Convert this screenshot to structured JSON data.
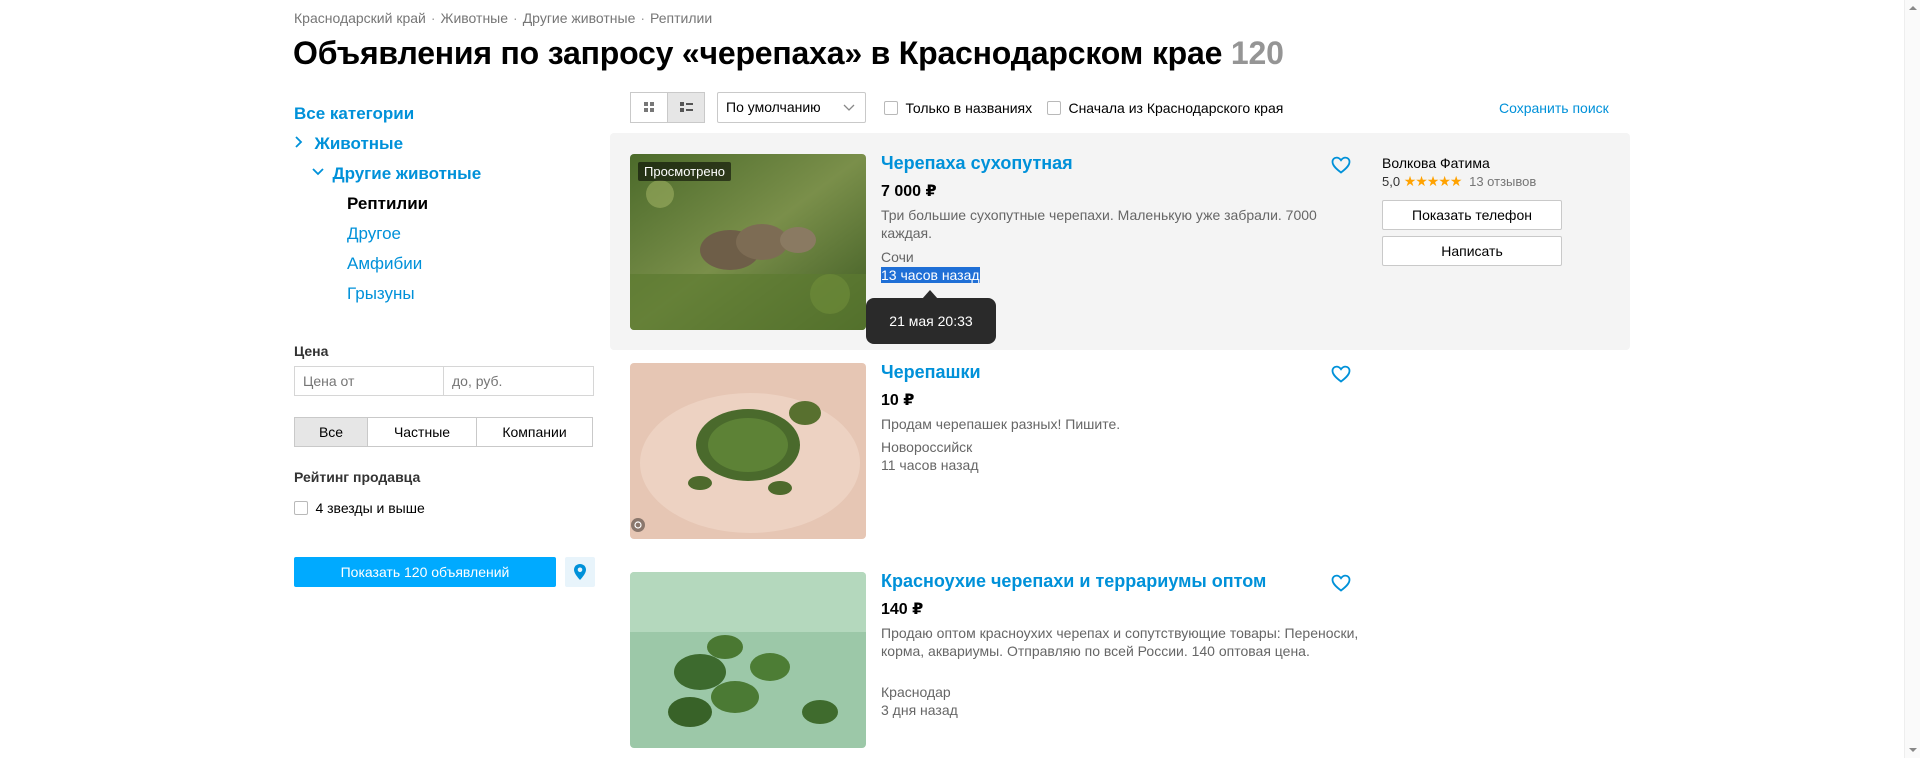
{
  "breadcrumb": [
    "Краснодарский край",
    "Животные",
    "Другие животные",
    "Рептилии"
  ],
  "breadcrumb_separator": "·",
  "page_title": "Объявления по запросу «черепаха» в Краснодарском крае",
  "result_count": "120",
  "sidebar": {
    "all_categories": "Все категории",
    "animals": "Животные",
    "other_animals": "Другие животные",
    "subcategories": [
      {
        "label": "Рептилии",
        "active": true
      },
      {
        "label": "Другое",
        "active": false
      },
      {
        "label": "Амфибии",
        "active": false
      },
      {
        "label": "Грызуны",
        "active": false
      }
    ],
    "price_label": "Цена",
    "price_from_placeholder": "Цена от",
    "price_to_placeholder": "до, руб.",
    "seller_types": [
      "Все",
      "Частные",
      "Компании"
    ],
    "seller_type_selected": "Все",
    "rating_label": "Рейтинг продавца",
    "rating_option": "4 звезды и выше",
    "show_button": "Показать 120 объявлений"
  },
  "toolbar": {
    "sort_value": "По умолчанию",
    "only_titles": "Только в названиях",
    "region_first": "Сначала из Краснодарского края",
    "save_search": "Сохранить поиск"
  },
  "listings": [
    {
      "badge": "Просмотрено",
      "title": "Черепаха сухопутная",
      "price": "7 000 ₽",
      "description": "Три большие сухопутные черепахи. Маленькую уже забрали. 7000 каждая.",
      "city": "Сочи",
      "time": "13 часов назад"
    },
    {
      "title": "Черепашки",
      "price": "10 ₽",
      "description": "Продам черепашек разных! Пишите.",
      "city": "Новороссийск",
      "time": "11 часов назад"
    },
    {
      "title": "Красноухие черепахи и террариумы оптом",
      "price": "140 ₽",
      "description": "Продаю оптом красноухих черепах и сопутствующие товары: Переноски, корма, аквариумы. Отправляю по всей России. 140 оптовая цена.",
      "city": "Краснодар",
      "time": "3 дня назад"
    }
  ],
  "seller": {
    "name": "Волкова Фатима",
    "rating": "5,0",
    "stars": "★★★★★",
    "reviews": "13 отзывов",
    "show_phone": "Показать телефон",
    "write": "Написать"
  },
  "tooltip": "21 мая 20:33",
  "colors": {
    "link": "#0091d9",
    "button_blue": "#00aaff",
    "star": "#ffa200",
    "highlight": "#1f6fd6"
  }
}
